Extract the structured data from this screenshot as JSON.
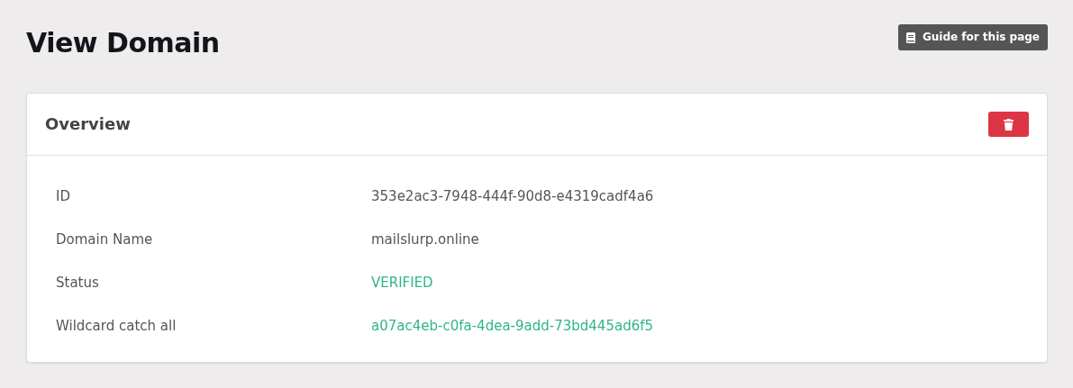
{
  "page": {
    "title": "View Domain",
    "guide_button": "Guide for this page"
  },
  "card": {
    "title": "Overview",
    "rows": [
      {
        "label": "ID",
        "value": "353e2ac3-7948-444f-90d8-e4319cadf4a6",
        "kind": "text"
      },
      {
        "label": "Domain Name",
        "value": "mailslurp.online",
        "kind": "text"
      },
      {
        "label": "Status",
        "value": "VERIFIED",
        "kind": "status"
      },
      {
        "label": "Wildcard catch all",
        "value": "a07ac4eb-c0fa-4dea-9add-73bd445ad6f5",
        "kind": "link"
      }
    ]
  }
}
